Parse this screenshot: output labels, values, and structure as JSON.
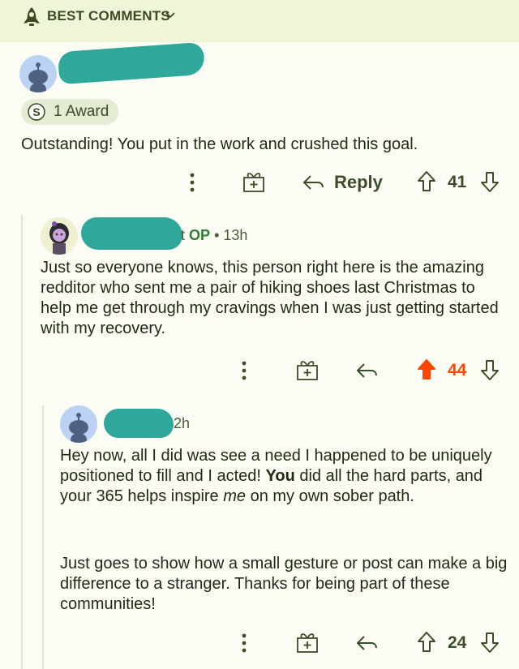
{
  "sort": {
    "label": "BEST COMMENTS",
    "icon": "rocket-icon"
  },
  "comments": [
    {
      "award": {
        "count_label": "1 Award",
        "icon": "silver-award-icon"
      },
      "body": "Outstanding! You put in the work and crushed this goal.",
      "actions": {
        "reply_label": "Reply",
        "score": "41",
        "upvoted": false
      }
    },
    {
      "author_suffix": "t",
      "op_label": "OP",
      "separator": "•",
      "age": "13h",
      "body": "Just so everyone knows, this person right here is the amazing redditor who sent me a pair of hiking shoes last Christmas to help me get through my cravings when I was just getting started with my recovery.",
      "actions": {
        "score": "44",
        "upvoted": true
      }
    },
    {
      "age": "2h",
      "body_part1_a": "Hey now, all I did was see a need I happened to be uniquely positioned to fill and I acted! ",
      "body_part1_bold": "You",
      "body_part1_b": " did all the hard parts, and your 365 helps inspire ",
      "body_part1_italic": "me",
      "body_part1_c": " on my own sober path.",
      "body_part2": "Just goes to show how a small gesture or post can make a big difference to a stranger. Thanks for being part of these communities!",
      "actions": {
        "score": "24",
        "upvoted": false
      }
    }
  ],
  "colors": {
    "background": "#fbfdf4",
    "sort_bar": "#eef6d6",
    "upvote_active": "#ff4500",
    "redaction": "#2fa79a",
    "op_green": "#2e7d32"
  }
}
